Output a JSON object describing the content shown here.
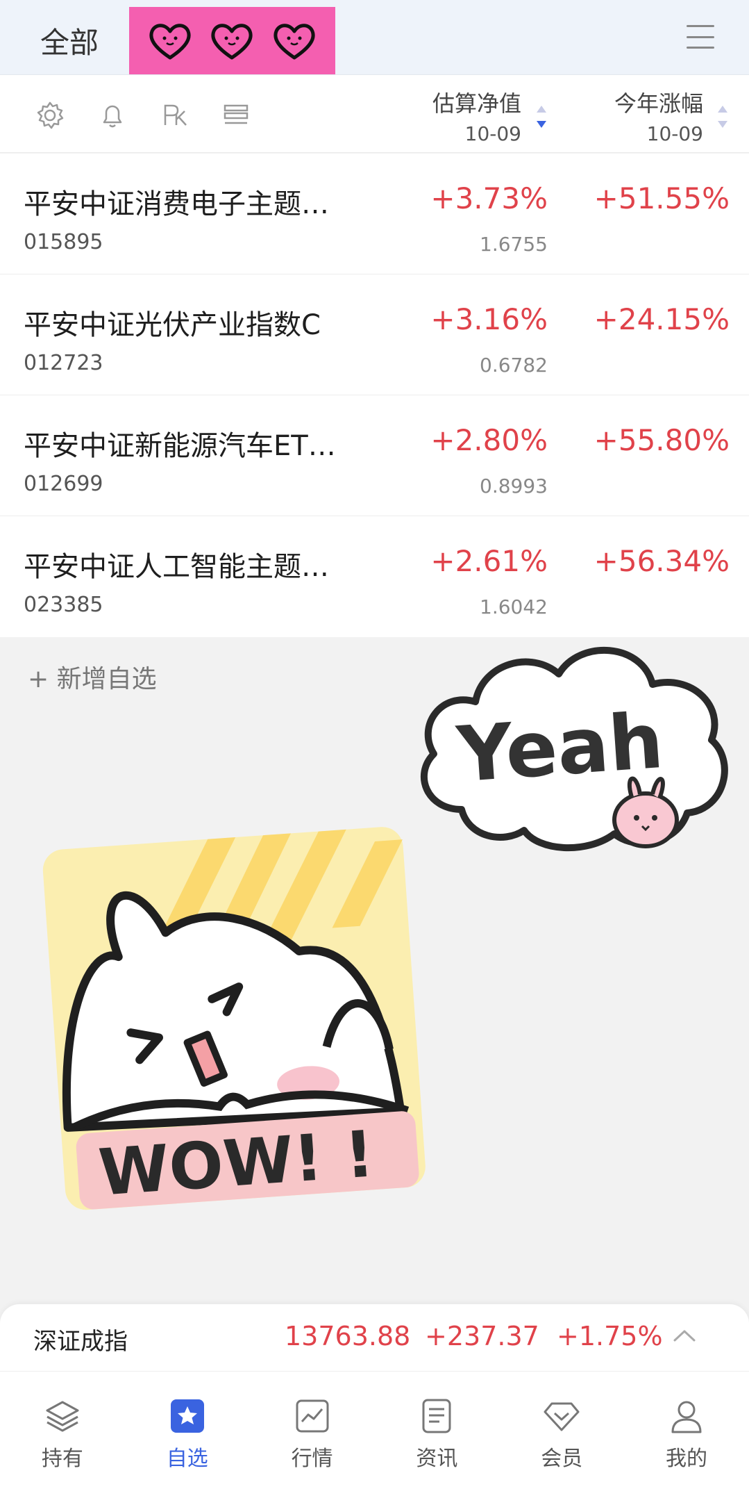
{
  "header": {
    "all_tab": "全部"
  },
  "columns": {
    "estimate": {
      "title": "估算净值",
      "date": "10-09"
    },
    "ytd": {
      "title": "今年涨幅",
      "date": "10-09"
    }
  },
  "funds": [
    {
      "name": "平安中证消费电子主题…",
      "code": "015895",
      "estimate_change": "+3.73%",
      "nav": "1.6755",
      "ytd_change": "+51.55%"
    },
    {
      "name": "平安中证光伏产业指数C",
      "code": "012723",
      "estimate_change": "+3.16%",
      "nav": "0.6782",
      "ytd_change": "+24.15%"
    },
    {
      "name": "平安中证新能源汽车ET…",
      "code": "012699",
      "estimate_change": "+2.80%",
      "nav": "0.8993",
      "ytd_change": "+55.80%"
    },
    {
      "name": "平安中证人工智能主题…",
      "code": "023385",
      "estimate_change": "+2.61%",
      "nav": "1.6042",
      "ytd_change": "+56.34%"
    }
  ],
  "add_watchlist": "+ 新增自选",
  "stickers": {
    "cloud_text": "Yeah",
    "wow_text": "WOW! !"
  },
  "index_bar": {
    "name": "深证成指",
    "value": "13763.88",
    "change": "+237.37",
    "percent": "+1.75%"
  },
  "bottom_nav": [
    {
      "label": "持有",
      "icon": "layers-icon"
    },
    {
      "label": "自选",
      "icon": "star-icon"
    },
    {
      "label": "行情",
      "icon": "chart-icon"
    },
    {
      "label": "资讯",
      "icon": "document-icon"
    },
    {
      "label": "会员",
      "icon": "diamond-icon"
    },
    {
      "label": "我的",
      "icon": "user-icon"
    }
  ],
  "colors": {
    "up_red": "#e0424a",
    "active_blue": "#3a63e0",
    "hearts_bg": "#f45fb0"
  }
}
